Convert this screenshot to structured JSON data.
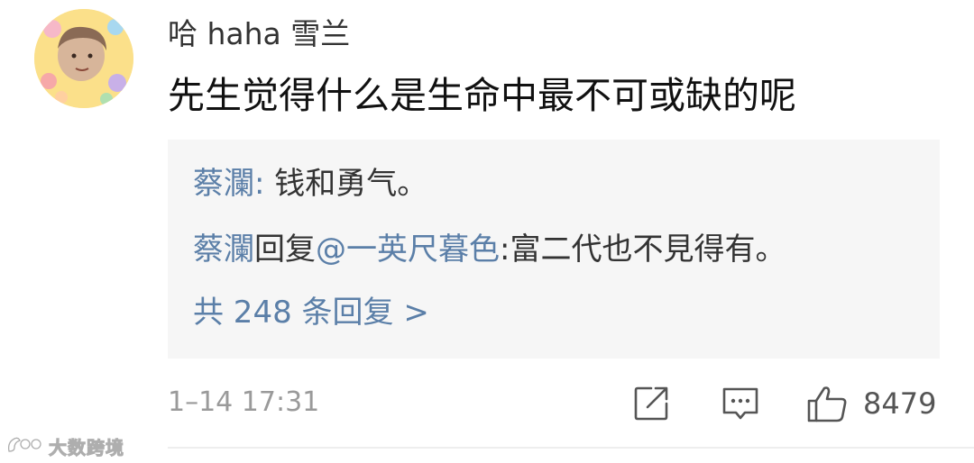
{
  "comment": {
    "username": "哈 haha 雪兰",
    "text": "先生觉得什么是生命中最不可或缺的呢",
    "timestamp": "1–14 17:31",
    "like_count": "8479"
  },
  "replies": {
    "items": [
      {
        "author": "蔡瀾",
        "separator": ": ",
        "text": "钱和勇气。"
      },
      {
        "author": "蔡瀾",
        "action": "回复",
        "mention": "@一英尺暮色",
        "separator": ":",
        "text": "富二代也不見得有。"
      }
    ],
    "more_label": "共 248 条回复 >"
  },
  "icons": {
    "share": "share-icon",
    "comment": "comment-icon",
    "like": "thumbs-up-icon"
  },
  "watermark": {
    "text": "大数跨境"
  },
  "colors": {
    "link": "#5b7fa8",
    "reply_background": "#f6f6f6",
    "muted": "#9a9a9a"
  }
}
